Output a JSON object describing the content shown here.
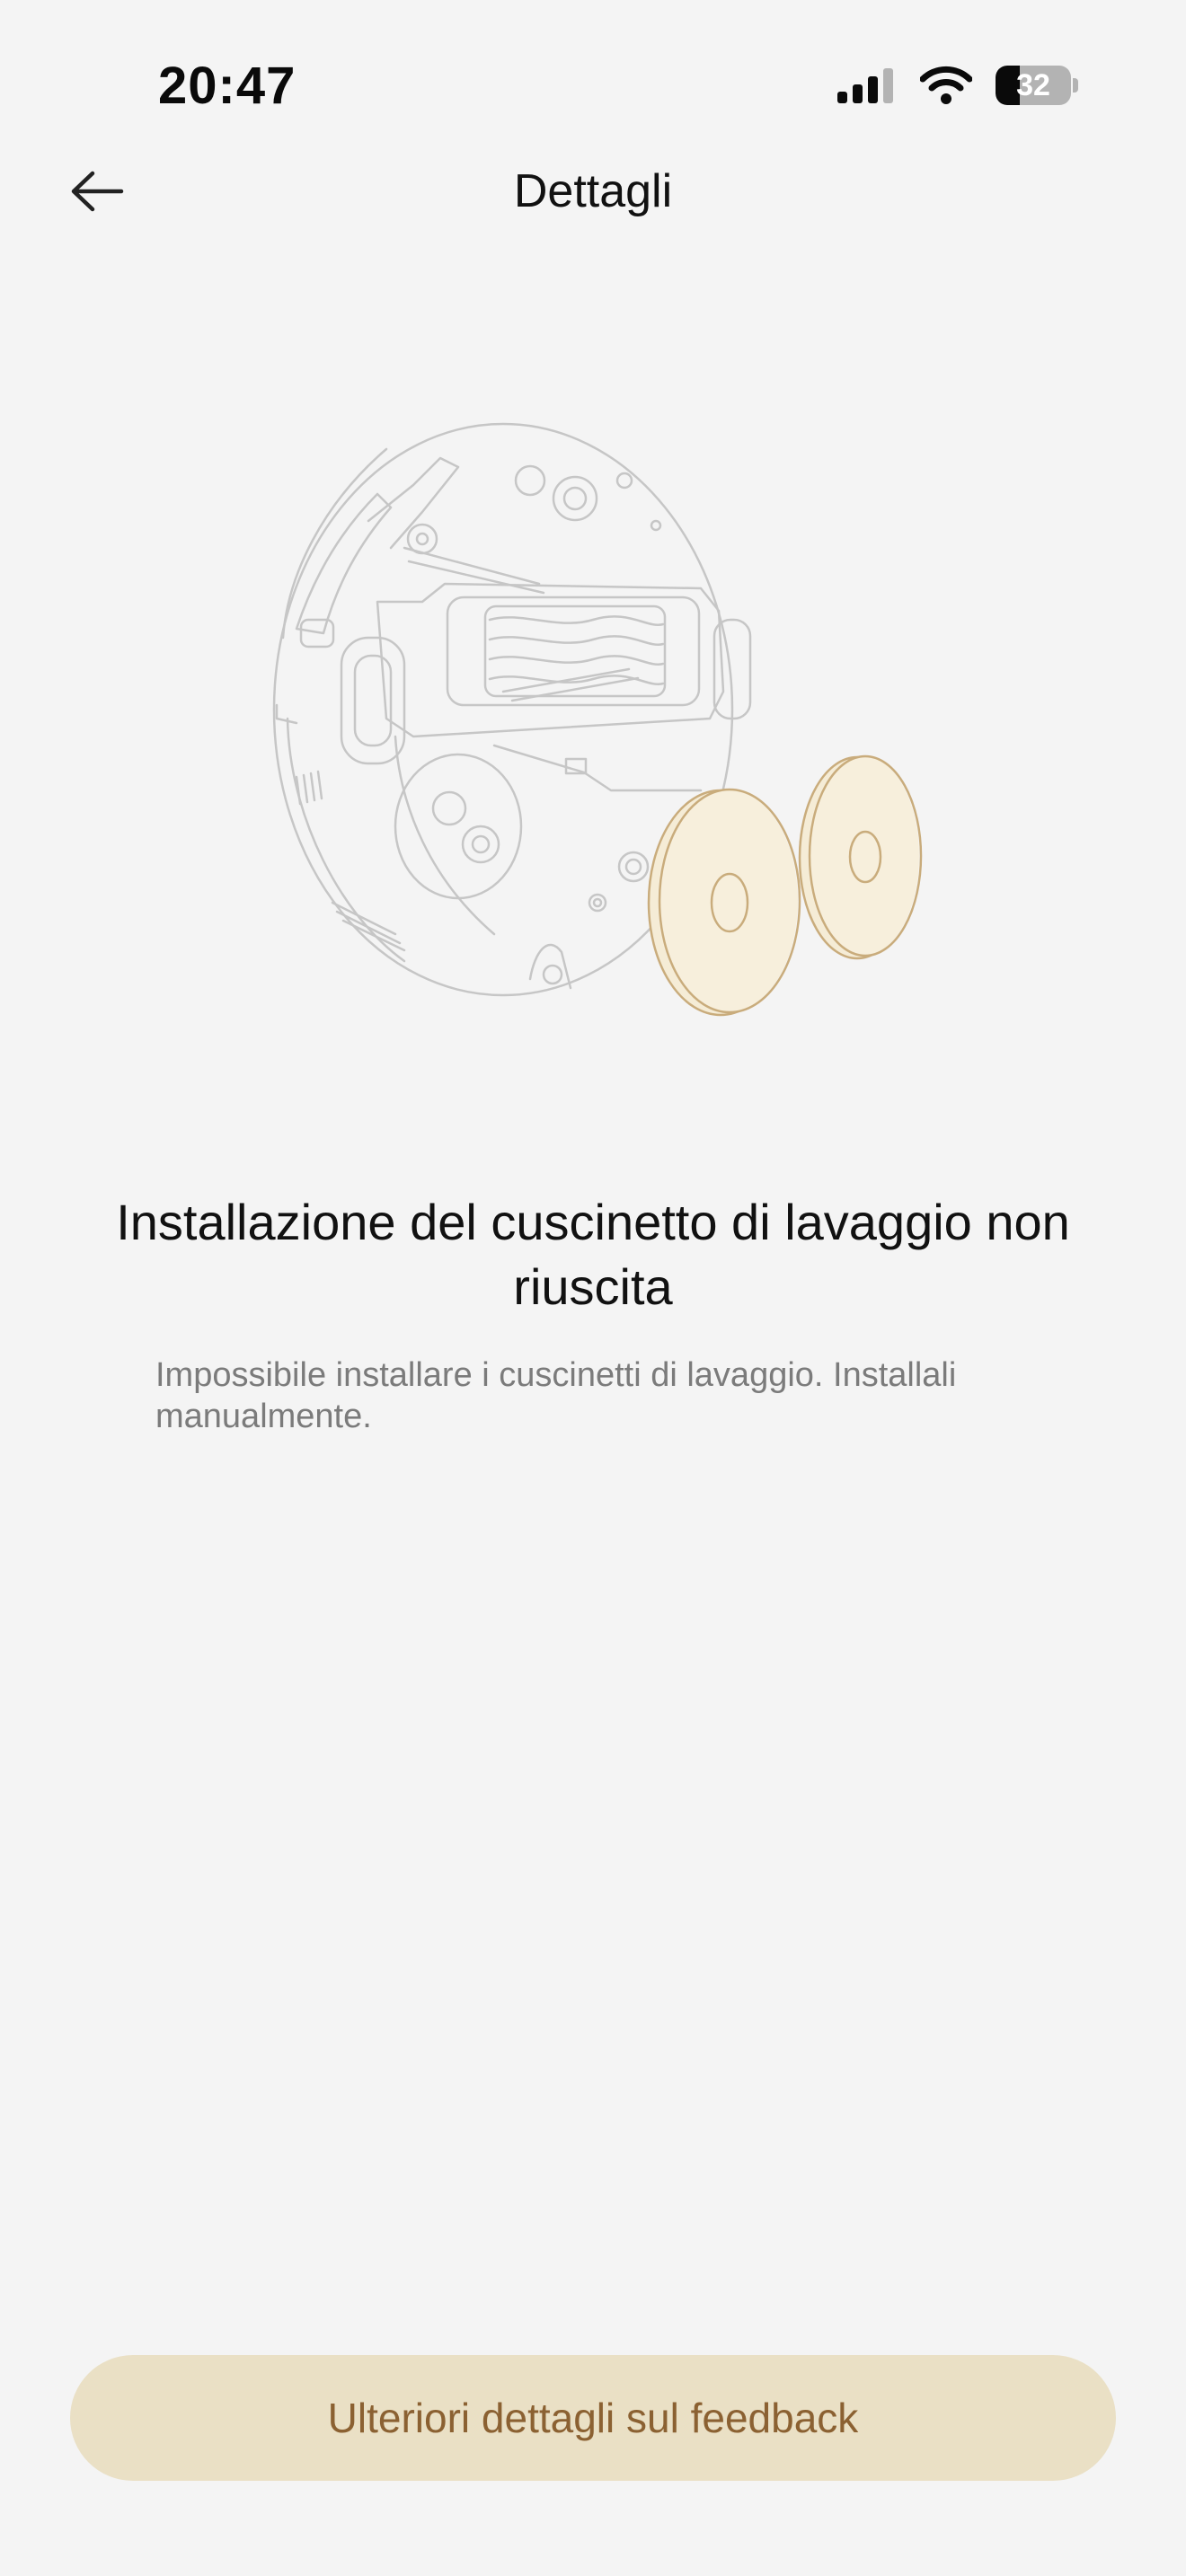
{
  "status_bar": {
    "time": "20:47",
    "battery_level": "32",
    "battery_fraction": 0.32,
    "signal_icon": "cellular-signal-icon",
    "wifi_icon": "wifi-icon"
  },
  "header": {
    "title": "Dettagli",
    "back_icon": "arrow-left-icon"
  },
  "illustration": {
    "icon": "robot-vacuum-with-mop-pads-illustration",
    "line_color": "#c6c6c6",
    "pad_fill": "#f5ecd6",
    "pad_stroke": "#c9ac7c"
  },
  "message": {
    "title": "Installazione del cuscinetto di lavaggio non riuscita",
    "description": "Impossibile installare i cuscinetti di lavaggio. Installali manualmente."
  },
  "actions": {
    "feedback_button_label": "Ulteriori dettagli sul feedback"
  },
  "colors": {
    "background": "#f4f4f4",
    "button_background": "#eae0c5",
    "button_text": "#8b6132",
    "description_text": "#7b7b7b"
  }
}
